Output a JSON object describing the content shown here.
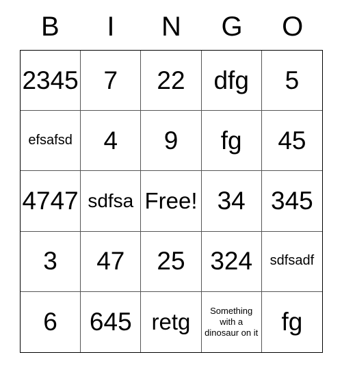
{
  "card": {
    "header": {
      "letters": [
        "B",
        "I",
        "N",
        "G",
        "O"
      ]
    },
    "grid": {
      "rows": 5,
      "columns": 5,
      "border_color": "#000000",
      "line_color": "#555555",
      "cell_background": "#ffffff",
      "text_color": "#000000",
      "cells": [
        {
          "text": "2345",
          "size": "xl"
        },
        {
          "text": "7",
          "size": "xl"
        },
        {
          "text": "22",
          "size": "xl"
        },
        {
          "text": "dfg",
          "size": "xl"
        },
        {
          "text": "5",
          "size": "xl"
        },
        {
          "text": "efsafsd",
          "size": "sm"
        },
        {
          "text": "4",
          "size": "xl"
        },
        {
          "text": "9",
          "size": "xl"
        },
        {
          "text": "fg",
          "size": "xl"
        },
        {
          "text": "45",
          "size": "xl"
        },
        {
          "text": "4747",
          "size": "xl"
        },
        {
          "text": "sdfsa",
          "size": "md"
        },
        {
          "text": "Free!",
          "size": "lg"
        },
        {
          "text": "34",
          "size": "xl"
        },
        {
          "text": "345",
          "size": "xl"
        },
        {
          "text": "3",
          "size": "xl"
        },
        {
          "text": "47",
          "size": "xl"
        },
        {
          "text": "25",
          "size": "xl"
        },
        {
          "text": "324",
          "size": "xl"
        },
        {
          "text": "sdfsadf",
          "size": "sm"
        },
        {
          "text": "6",
          "size": "xl"
        },
        {
          "text": "645",
          "size": "xl"
        },
        {
          "text": "retg",
          "size": "lg"
        },
        {
          "text": "Something with a dinosaur on it",
          "size": "xs"
        },
        {
          "text": "fg",
          "size": "xl"
        }
      ]
    }
  }
}
